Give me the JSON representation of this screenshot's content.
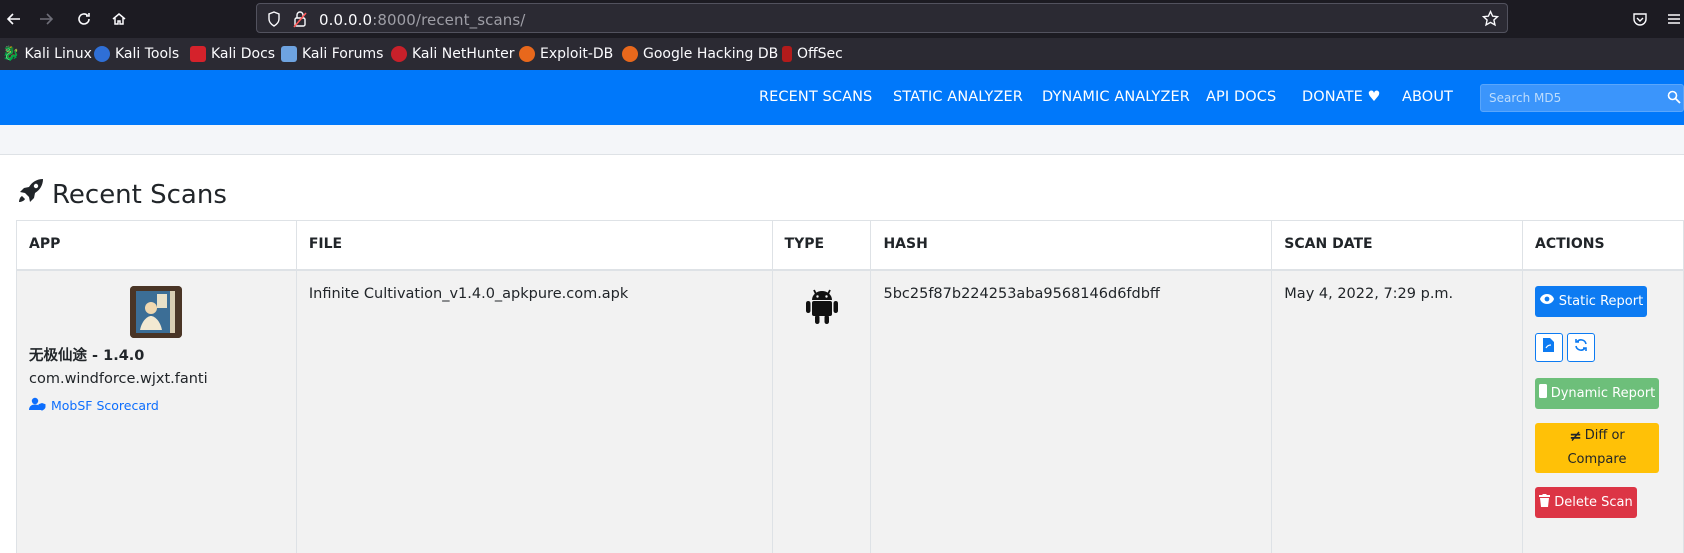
{
  "browser": {
    "url_host": "0.0.0.0",
    "url_rest": ":8000/recent_scans/",
    "bookmarks": [
      "Kali Linux",
      "Kali Tools",
      "Kali Docs",
      "Kali Forums",
      "Kali NetHunter",
      "Exploit-DB",
      "Google Hacking DB",
      "OffSec"
    ]
  },
  "nav": {
    "links": [
      "RECENT SCANS",
      "STATIC ANALYZER",
      "DYNAMIC ANALYZER",
      "API DOCS",
      "DONATE ♥",
      "ABOUT"
    ],
    "search_placeholder": "Search MD5"
  },
  "page": {
    "title": "Recent Scans"
  },
  "table": {
    "headers": [
      "APP",
      "FILE",
      "TYPE",
      "HASH",
      "SCAN DATE",
      "ACTIONS"
    ],
    "rows": [
      {
        "app_name": "无极仙途 - 1.4.0",
        "package": "com.windforce.wjxt.fanti",
        "scorecard": "MobSF Scorecard",
        "file": "Infinite Cultivation_v1.4.0_apkpure.com.apk",
        "type_icon": "android-icon",
        "hash": "5bc25f87b224253aba9568146d6fdbff",
        "scan_date": "May 4, 2022, 7:29 p.m.",
        "actions": {
          "static": "Static Report",
          "dynamic": "Dynamic Report",
          "diff_line1": "Diff or",
          "diff_line2": "Compare",
          "delete": "Delete Scan"
        }
      }
    ]
  },
  "colors": {
    "navbar": "#0078fa",
    "static_btn": "#0d7bf2",
    "dynamic_btn": "#6dbf7a",
    "diff_btn": "#ffc107",
    "delete_btn": "#dc3545"
  }
}
